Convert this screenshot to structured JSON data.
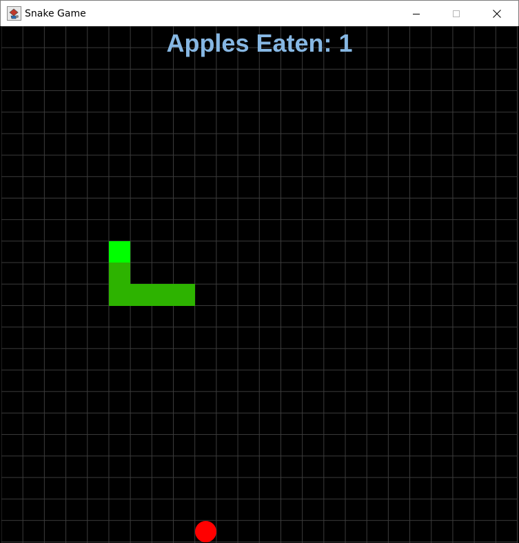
{
  "window": {
    "title": "Snake Game",
    "icon": "java-cup-icon",
    "controls": [
      "minimize",
      "maximize",
      "close"
    ]
  },
  "score": {
    "label": "Apples Eaten: 1",
    "apples_eaten": 1,
    "color": "#86b7e3"
  },
  "board": {
    "columns": 24,
    "rows": 24,
    "background": "#000000",
    "grid_color": "#3c3c3c"
  },
  "snake": {
    "head_color": "#00ff00",
    "body_color": "#2db300",
    "segments": [
      {
        "col": 5,
        "row": 10,
        "part": "head"
      },
      {
        "col": 5,
        "row": 11,
        "part": "body"
      },
      {
        "col": 5,
        "row": 12,
        "part": "body"
      },
      {
        "col": 6,
        "row": 12,
        "part": "body"
      },
      {
        "col": 7,
        "row": 12,
        "part": "body"
      },
      {
        "col": 8,
        "row": 12,
        "part": "body"
      }
    ]
  },
  "apple": {
    "col": 9,
    "row": 23,
    "color": "#ff0000"
  }
}
